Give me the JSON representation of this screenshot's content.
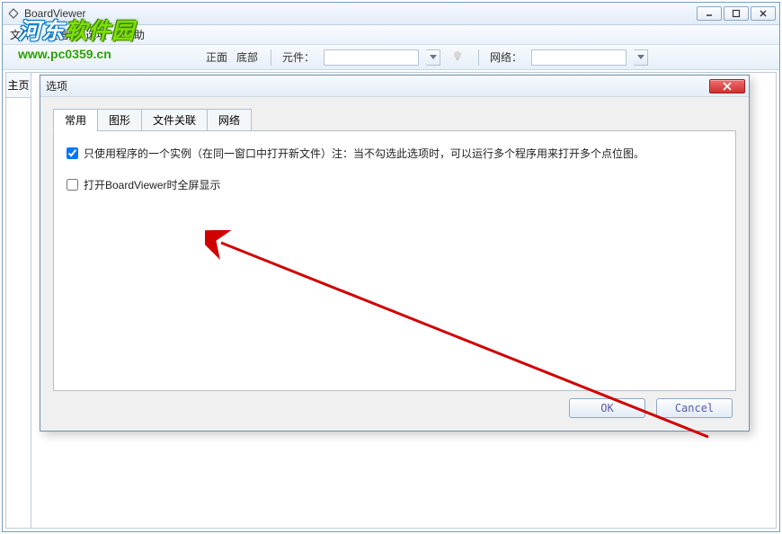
{
  "main_window": {
    "title": "BoardViewer"
  },
  "menubar": {
    "file": "文件",
    "view": "查看",
    "options": "选项",
    "help": "帮助"
  },
  "toolbar": {
    "front": "正面",
    "bottom": "底部",
    "component_label": "元件：",
    "component_value": "",
    "net_label": "网络：",
    "net_value": ""
  },
  "side_tab": {
    "home": "主页"
  },
  "dialog": {
    "title": "选项",
    "tabs": {
      "general": "常用",
      "graphics": "图形",
      "file_assoc": "文件关联",
      "network": "网络"
    },
    "options": {
      "single_instance": "只使用程序的一个实例（在同一窗口中打开新文件）注：当不勾选此选项时，可以运行多个程序用来打开多个点位图。",
      "single_instance_checked": true,
      "fullscreen": "打开BoardViewer时全屏显示",
      "fullscreen_checked": false
    },
    "buttons": {
      "ok": "OK",
      "cancel": "Cancel"
    }
  },
  "watermark": {
    "line1a": "河东",
    "line1b": "软件园",
    "line2": "www.pc0359.cn"
  }
}
